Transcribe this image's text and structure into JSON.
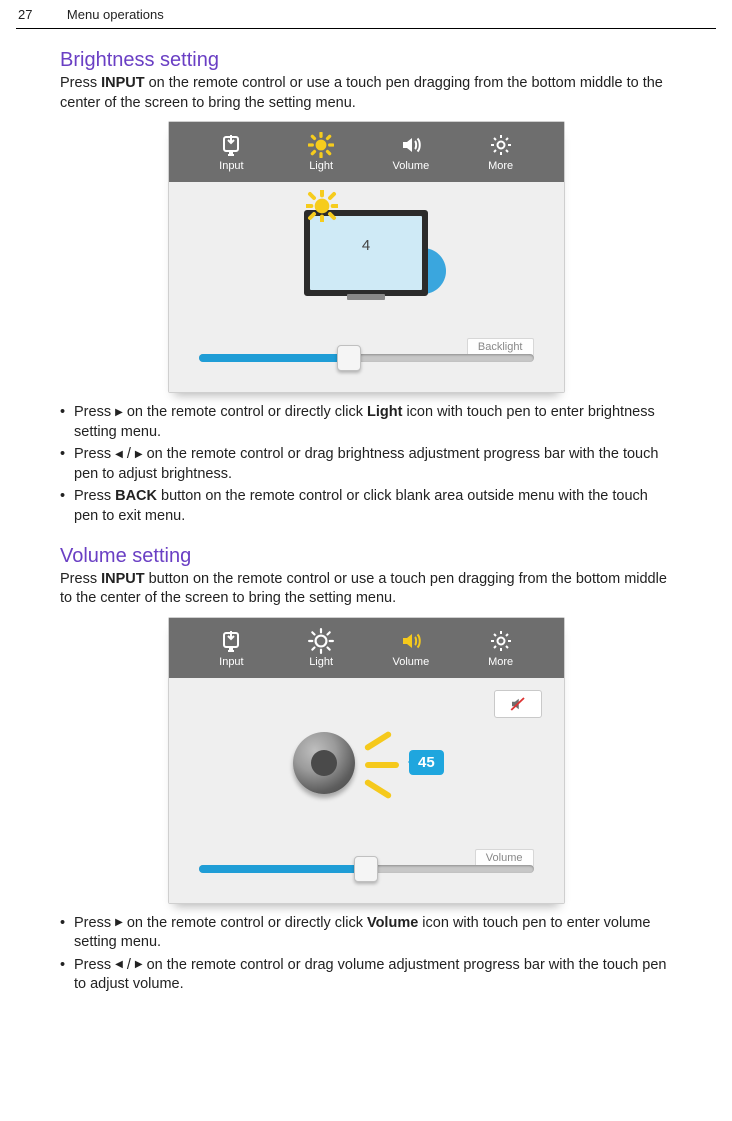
{
  "page": {
    "number": "27",
    "title": "Menu operations"
  },
  "section1": {
    "title": "Brightness setting"
  },
  "section2": {
    "title": "Volume setting"
  },
  "intro1_a": "Press ",
  "intro1_b": "INPUT",
  "intro1_c": " on the remote control or use a touch pen dragging from the bottom middle to the center of the screen to bring the setting menu.",
  "intro2_a": "Press ",
  "intro2_b": "INPUT",
  "intro2_c": " button on the remote control or use a touch pen dragging from the bottom middle to the center of the screen to bring the setting menu.",
  "tabs": {
    "input": "Input",
    "light": "Light",
    "volume": "Volume",
    "more": "More"
  },
  "ui1": {
    "value": "4",
    "slider_label": "Backlight"
  },
  "ui2": {
    "value": "45",
    "slider_label": "Volume"
  },
  "bul1": {
    "i1a": "Press  ",
    "i1b": " on the remote control or directly click ",
    "i1c": "Light",
    "i1d": " icon with touch pen to enter brightness setting menu.",
    "i2a": "Press  ",
    "i2b": "  on the remote control or drag brightness adjustment progress bar with the touch pen to adjust brightness.",
    "i3a": "Press ",
    "i3b": "BACK",
    "i3c": " button on the remote control or click blank area outside menu with the touch pen to exit menu."
  },
  "bul2": {
    "i1a": "Press  ",
    "i1b": " on the remote control or directly click ",
    "i1c": "Volume",
    "i1d": " icon with touch pen to enter volume setting menu.",
    "i2a": "Press  ",
    "i2b": "  on the remote control or drag volume adjustment progress bar with the touch pen to adjust volume."
  },
  "glyph": {
    "right": "▶",
    "left": "◀",
    "slash": " / "
  }
}
